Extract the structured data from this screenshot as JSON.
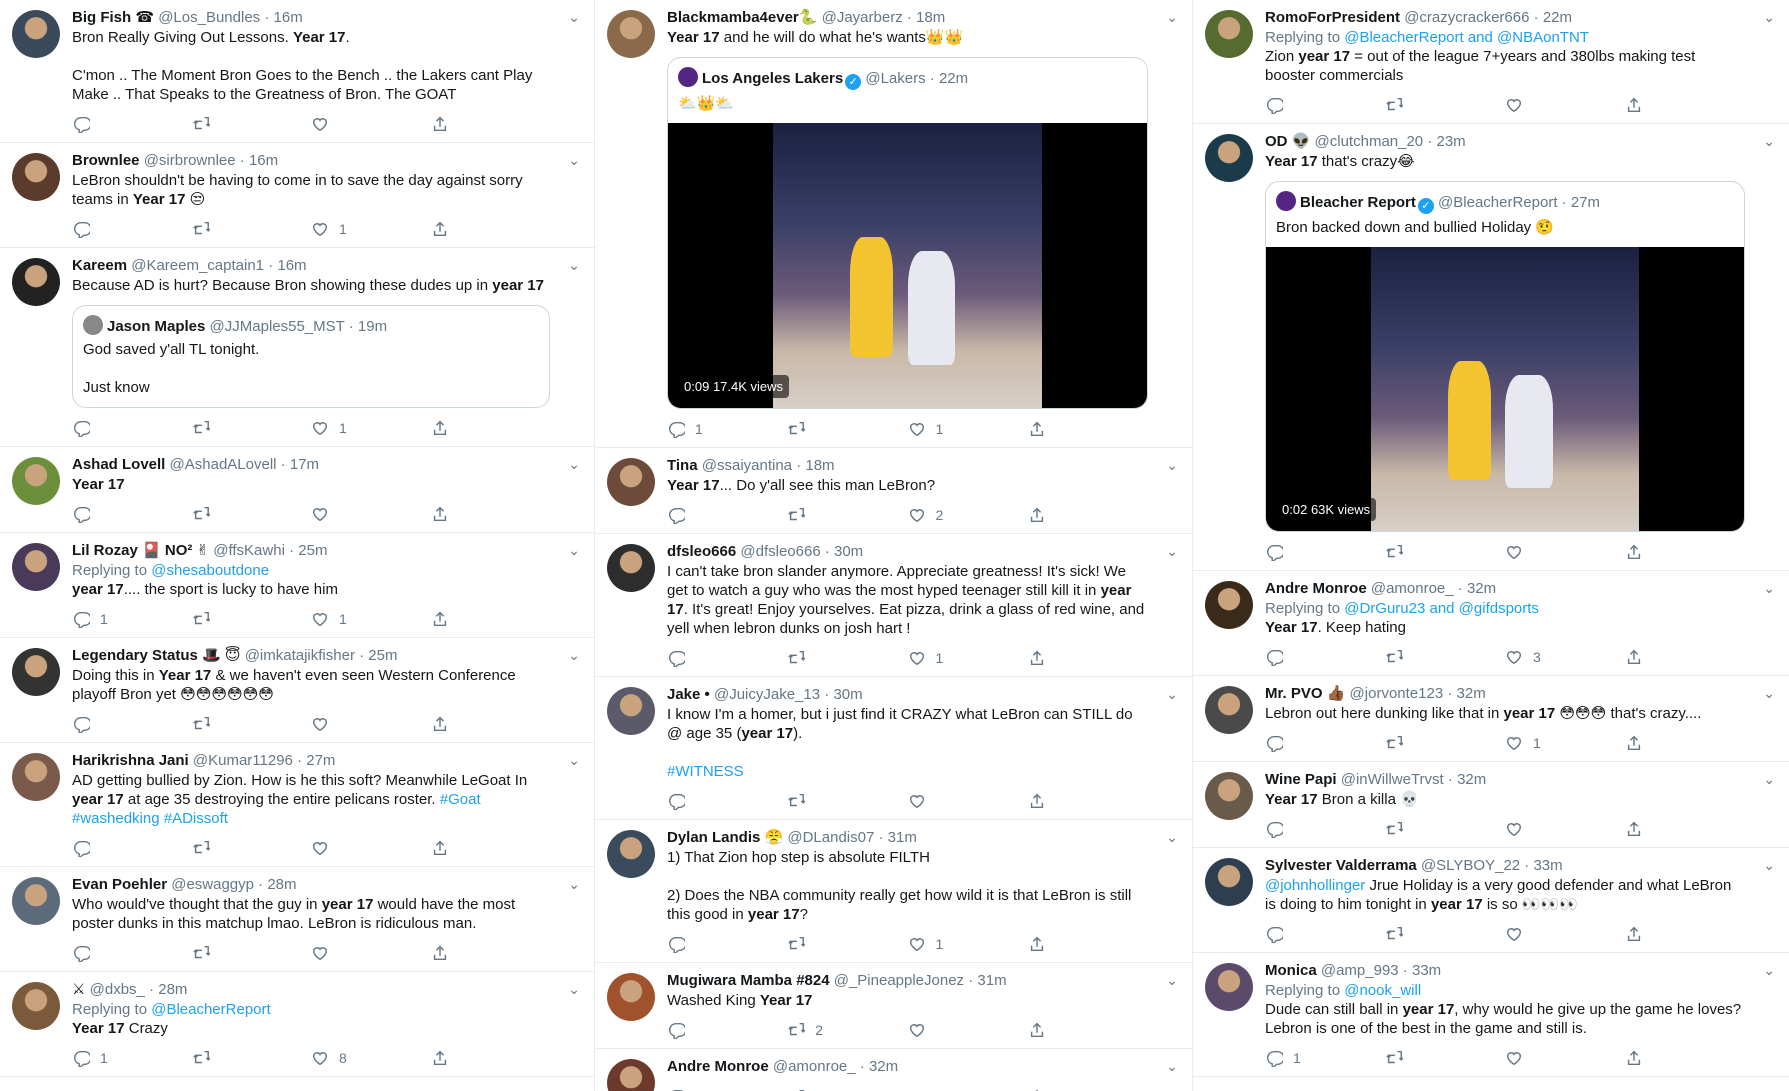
{
  "col1": [
    {
      "name": "Big Fish ☎",
      "handle": "@Los_Bundles",
      "time": "16m",
      "text": "Bron Really Giving Out Lessons. ",
      "bold": "Year 17",
      "text2": ".\n\nC'mon .. The Moment Bron Goes to the Bench .. the Lakers cant Play Make .. That Speaks to the Greatness of Bron. The GOAT",
      "replies": "",
      "likes": ""
    },
    {
      "name": "Brownlee",
      "handle": "@sirbrownlee",
      "time": "16m",
      "text": "LeBron shouldn't be having to come in to save the day against sorry teams in ",
      "bold": "Year 17",
      "text2": " 😒",
      "replies": "",
      "likes": "1"
    },
    {
      "name": "Kareem",
      "handle": "@Kareem_captain1",
      "time": "16m",
      "text": "Because AD is hurt? Because Bron showing these dudes up in ",
      "bold": "year 17",
      "text2": "",
      "quote": {
        "name": "Jason Maples",
        "handle": "@JJMaples55_MST",
        "time": "19m",
        "text": "God saved y'all TL tonight.\n\nJust know"
      },
      "replies": "",
      "likes": "1"
    },
    {
      "name": "Ashad Lovell",
      "handle": "@AshadALovell",
      "time": "17m",
      "text": "",
      "bold": "Year 17",
      "text2": "",
      "replies": "",
      "likes": ""
    },
    {
      "name": "Lil Rozay 🎴 NO² ✌",
      "handle": "@ffsKawhi",
      "time": "25m",
      "replying": "@shesaboutdone",
      "text": "",
      "bold": "year 17",
      "text2": ".... the sport is lucky to have him",
      "replies": "1",
      "likes": "1"
    },
    {
      "name": "Legendary Status 🎩 😇",
      "handle": "@imkatajikfisher",
      "time": "25m",
      "text": "Doing this in ",
      "bold": "Year 17",
      "text2": " & we haven't even seen Western Conference playoff Bron yet 😳😳😳😳😳😳",
      "replies": "",
      "likes": ""
    },
    {
      "name": "Harikrishna Jani",
      "handle": "@Kumar11296",
      "time": "27m",
      "text": "AD getting bullied by Zion. How is he this soft? Meanwhile LeGoat In ",
      "bold": "year 17",
      "text2": " at age 35 destroying the entire pelicans roster. ",
      "tags": "#Goat #washedking #ADissoft",
      "replies": "",
      "likes": ""
    },
    {
      "name": "Evan Poehler",
      "handle": "@eswaggyp",
      "time": "28m",
      "text": "Who would've thought that the guy in ",
      "bold": "year 17",
      "text2": " would have the most poster dunks in this matchup lmao. LeBron is ridiculous man.",
      "replies": "",
      "likes": ""
    },
    {
      "name": "⚔",
      "handle": "@dxbs_",
      "time": "28m",
      "replying": "@BleacherReport",
      "text": "",
      "bold": "Year 17",
      "text2": " Crazy",
      "replies": "1",
      "likes": "8"
    }
  ],
  "col2": [
    {
      "name": "Blackmamba4ever🐍",
      "handle": "@Jayarberz",
      "time": "18m",
      "text": "",
      "bold": "Year 17",
      "text2": " and he will do what he's wants👑👑",
      "quote": {
        "name": "Los Angeles Lakers",
        "verified": true,
        "handle": "@Lakers",
        "time": "22m",
        "text": "⛅👑⛅",
        "video": {
          "time": "0:09",
          "views": "17.4K views"
        }
      },
      "replies": "1",
      "likes": "1"
    },
    {
      "name": "Tina",
      "handle": "@ssaiyantina",
      "time": "18m",
      "text": "",
      "bold": "Year 17",
      "text2": "... Do y'all see this man LeBron?",
      "replies": "",
      "likes": "2"
    },
    {
      "name": "dfsleo666",
      "handle": "@dfsleo666",
      "time": "30m",
      "text": "I can't take bron slander anymore. Appreciate greatness! It's sick! We get to watch a guy who was the most hyped teenager still kill it in ",
      "bold": "year 17",
      "text2": ". It's great! Enjoy yourselves. Eat pizza, drink a glass of red wine, and yell when lebron dunks on josh hart !",
      "replies": "",
      "likes": "1"
    },
    {
      "name": "Jake •",
      "handle": "@JuicyJake_13",
      "time": "30m",
      "text": "I know I'm a homer, but i just find it CRAZY what LeBron can STILL do @ age 35 (",
      "bold": "year 17",
      "text2": ").\n\n",
      "tags": "#WITNESS",
      "replies": "",
      "likes": ""
    },
    {
      "name": "Dylan Landis 😤",
      "handle": "@DLandis07",
      "time": "31m",
      "text": "1) That Zion hop step is absolute FILTH\n\n2) Does the NBA community really get how wild it is that LeBron is still this good in ",
      "bold": "year 17",
      "text2": "?",
      "replies": "",
      "likes": "1"
    },
    {
      "name": "Mugiwara Mamba #824",
      "handle": "@_PineappleJonez",
      "time": "31m",
      "text": "Washed King ",
      "bold": "Year 17",
      "text2": "",
      "replies": "",
      "retweets": "2",
      "likes": ""
    },
    {
      "name": "Andre Monroe",
      "handle": "@amonroe_",
      "time": "32m",
      "text": "",
      "bold": "",
      "text2": "",
      "replies": "",
      "likes": ""
    }
  ],
  "col3": [
    {
      "name": "RomoForPresident",
      "handle": "@crazycracker666",
      "time": "22m",
      "replying": "@BleacherReport and @NBAonTNT",
      "text": "Zion ",
      "bold": "year 17",
      "text2": " = out of the league 7+years and 380lbs making test booster commercials",
      "replies": "",
      "likes": ""
    },
    {
      "name": "OD 👽",
      "handle": "@clutchman_20",
      "time": "23m",
      "text": "",
      "bold": "Year 17",
      "text2": " that's crazy😂",
      "quote": {
        "name": "Bleacher Report",
        "verified": true,
        "handle": "@BleacherReport",
        "time": "27m",
        "text": "Bron backed down and bullied Holiday 🤨",
        "video": {
          "time": "0:02",
          "views": "63K views"
        }
      },
      "replies": "",
      "likes": ""
    },
    {
      "name": "Andre Monroe",
      "handle": "@amonroe_",
      "time": "32m",
      "replying": "@DrGuru23 and @gifdsports",
      "text": "",
      "bold": "Year 17",
      "text2": ". Keep hating",
      "replies": "",
      "likes": "3"
    },
    {
      "name": "Mr. PVO 👍🏾",
      "handle": "@jorvonte123",
      "time": "32m",
      "text": "Lebron out here dunking like that in ",
      "bold": "year 17",
      "text2": " 😳😳😳 that's crazy....",
      "replies": "",
      "likes": "1"
    },
    {
      "name": "Wine Papi",
      "handle": "@inWillweTrvst",
      "time": "32m",
      "text": "",
      "bold": "Year 17",
      "text2": " Bron a killa 💀",
      "replies": "",
      "likes": ""
    },
    {
      "name": "Sylvester Valderrama",
      "handle": "@SLYBOY_22",
      "time": "33m",
      "text": "",
      "mention": "@johnhollinger",
      "text1b": " Jrue Holiday is a very good defender and what LeBron is doing to him tonight in ",
      "bold": "year 17",
      "text2": " is so 👀👀👀",
      "replies": "",
      "likes": ""
    },
    {
      "name": "Monica",
      "handle": "@amp_993",
      "time": "33m",
      "replying": "@nook_will",
      "text": "Dude can still ball in ",
      "bold": "year 17",
      "text2": ", why would he give up the game he loves? Lebron is one of the best in the game and still is.",
      "replies": "1",
      "likes": ""
    }
  ],
  "labels": {
    "replying": "Replying to ",
    "dot": " · "
  },
  "colors": {
    "link": "#1da1f2",
    "muted": "#657786",
    "border": "#e6ecf0"
  },
  "avatars": [
    "#3b4a5a",
    "#5a3b2c",
    "#222",
    "#6b8f3a",
    "#4a3a5a",
    "#333",
    "#7a5a4a",
    "#5c6b7a",
    "#7b5a3c",
    "#8b6a4c",
    "#6c4b3a",
    "#2d2d2d",
    "#5a5a6a",
    "#3a4b5c",
    "#a0522d",
    "#6b3a2a",
    "#556b2f",
    "#1c3b4a",
    "#3a2a1a",
    "#4a4a4a",
    "#6a5a4a",
    "#2c3e50",
    "#5b4a6a"
  ]
}
